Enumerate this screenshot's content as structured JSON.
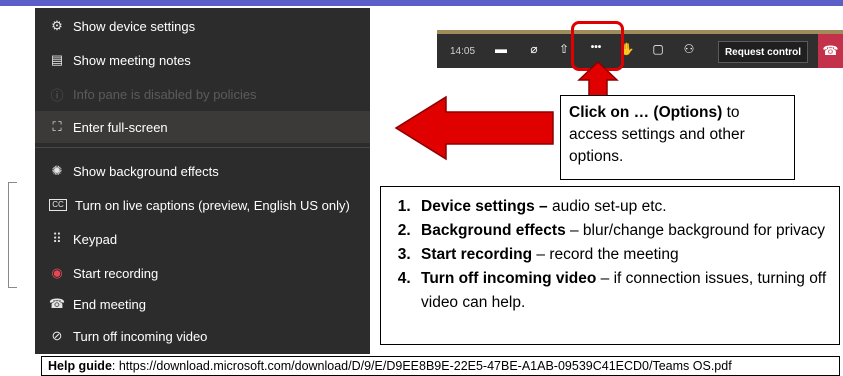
{
  "menu": {
    "items": [
      {
        "label": "Show device settings",
        "icon": "gear-icon",
        "glyph": "⚙"
      },
      {
        "label": "Show meeting notes",
        "icon": "notes-icon",
        "glyph": "▤"
      },
      {
        "label": "Info pane is disabled by policies",
        "icon": "info-icon",
        "glyph": "ⓘ"
      },
      {
        "label": "Enter full-screen",
        "icon": "fullscreen-icon",
        "glyph": "⛶"
      },
      {
        "label": "Show background effects",
        "icon": "background-effects-icon",
        "glyph": "✺"
      },
      {
        "label": "Turn on live captions (preview, English US only)",
        "icon": "captions-icon",
        "glyph": "CC"
      },
      {
        "label": "Keypad",
        "icon": "keypad-icon",
        "glyph": "⠿"
      },
      {
        "label": "Start recording",
        "icon": "record-icon",
        "glyph": "◉"
      },
      {
        "label": "End meeting",
        "icon": "end-meeting-icon",
        "glyph": "☎"
      },
      {
        "label": "Turn off incoming video",
        "icon": "video-off-icon",
        "glyph": "⊘"
      }
    ]
  },
  "toolbar": {
    "time": "14:05",
    "request_control_label": "Request control",
    "more_glyph": "•••"
  },
  "callout1": {
    "bold": "Click on … (Options)",
    "rest": " to access settings and other options."
  },
  "callout2": {
    "items": [
      {
        "bold": "Device settings –",
        "rest": " audio set-up etc."
      },
      {
        "bold": "Background effects",
        "rest": " – blur/change background for privacy"
      },
      {
        "bold": "Start recording",
        "rest": " – record the meeting"
      },
      {
        "bold": "Turn off incoming video",
        "rest": " – if connection issues, turning off video can help."
      }
    ]
  },
  "help": {
    "label": "Help guide",
    "url": ": https://download.microsoft.com/download/D/9/E/D9EE8B9E-22E5-47BE-A1AB-09539C41ECD0/Teams OS.pdf"
  },
  "colors": {
    "menu_bg": "#2d2c2c",
    "arrow_red": "#e00000",
    "hangup_red": "#c4314b",
    "accent": "#5b5fc7"
  }
}
